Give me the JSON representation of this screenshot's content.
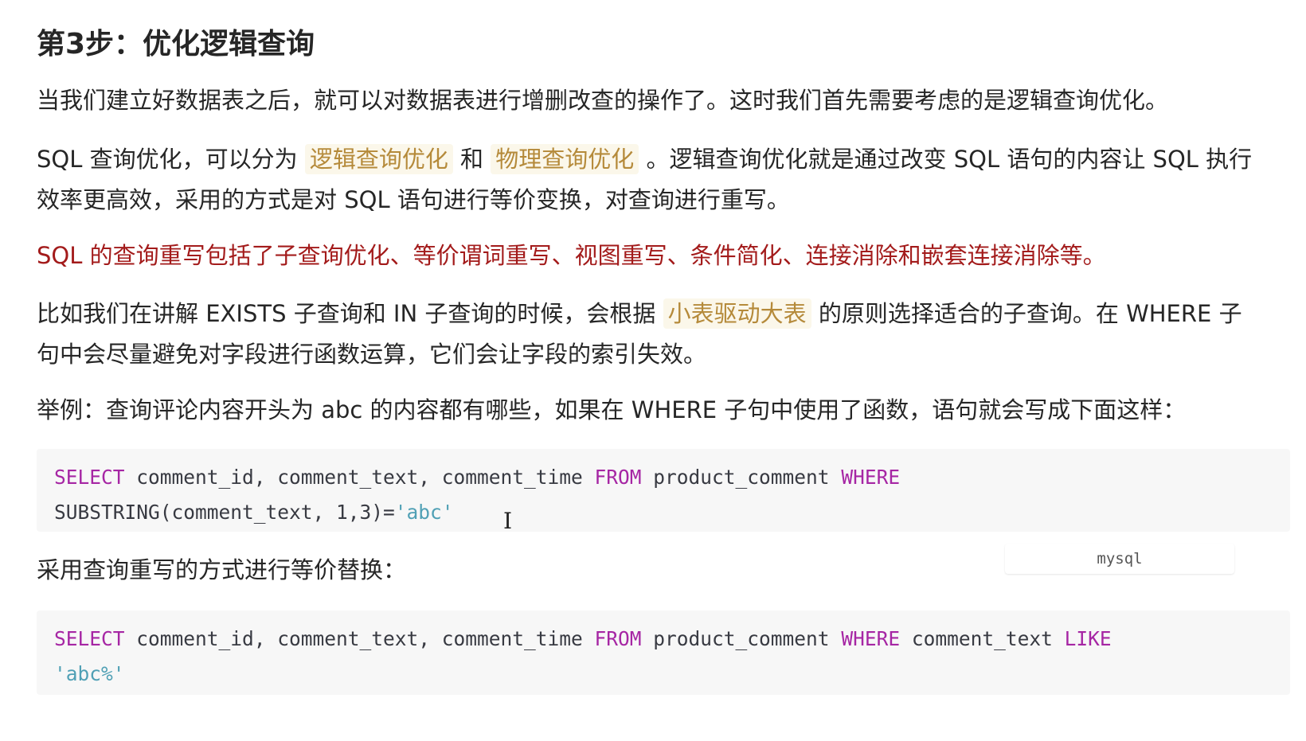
{
  "title": "第3步：优化逻辑查询",
  "p1": "当我们建立好数据表之后，就可以对数据表进行增删改查的操作了。这时我们首先需要考虑的是逻辑查询优化。",
  "p2": {
    "l1_a": "SQL 查询优化，可以分为 ",
    "hl1": "逻辑查询优化",
    "l1_b": " 和 ",
    "hl2": "物理查询优化",
    "l1_c": " 。逻辑查询优化就是通过改变 SQL 语句的内容让 SQL 执行",
    "l2": "效率更高效，采用的方式是对 SQL 语句进行等价变换，对查询进行重写。"
  },
  "p3": "SQL 的查询重写包括了子查询优化、等价谓词重写、视图重写、条件简化、连接消除和嵌套连接消除等。",
  "p4": {
    "l1_a": "比如我们在讲解 EXISTS 子查询和 IN 子查询的时候，会根据 ",
    "hl": "小表驱动大表",
    "l1_b": " 的原则选择适合的子查询。在 WHERE 子",
    "l2": "句中会尽量避免对字段进行函数运算，它们会让字段的索引失效。"
  },
  "p5": "举例：查询评论内容开头为 abc 的内容都有哪些，如果在 WHERE 子句中使用了函数，语句就会写成下面这样：",
  "code1": {
    "kw1": "SELECT",
    "t1": " comment_id, comment_text, comment_time ",
    "kw2": "FROM",
    "t2": " product_comment ",
    "kw3": "WHERE",
    "t3": "SUBSTRING(comment_text, 1,3)=",
    "s1": "'abc'"
  },
  "lang_tag": "mysql",
  "p6": "采用查询重写的方式进行等价替换：",
  "code2": {
    "kw1": "SELECT",
    "t1": " comment_id, comment_text, comment_time ",
    "kw2": "FROM",
    "t2": " product_comment ",
    "kw3": "WHERE",
    "t3": " comment_text ",
    "kw4": "LIKE",
    "s1": "'abc%'"
  }
}
